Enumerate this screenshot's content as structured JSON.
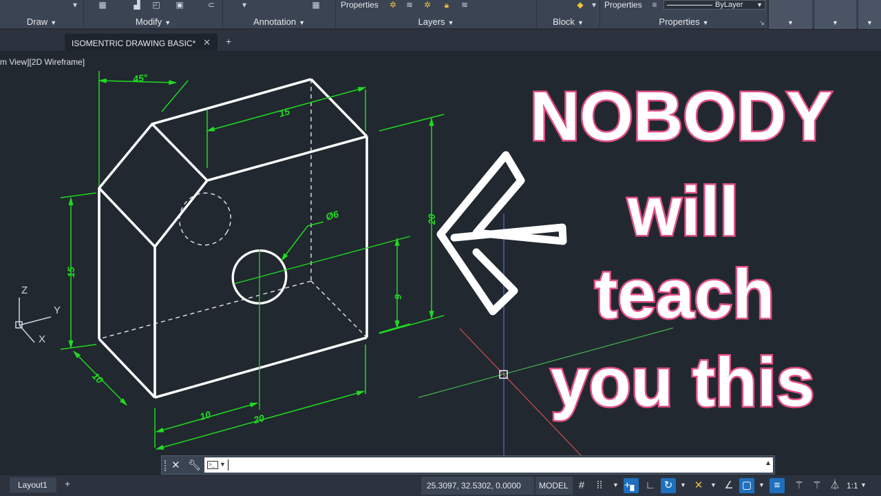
{
  "ribbon": {
    "panels": {
      "draw": "Draw",
      "modify": "Modify",
      "annotation": "Annotation",
      "layers": "Layers",
      "block": "Block",
      "properties": "Properties"
    },
    "layer_properties_label": "Properties",
    "properties_label": "Properties",
    "lineweight_value": "ByLayer"
  },
  "tabs": {
    "active": "ISOMENTRIC DRAWING BASIC*"
  },
  "viewport": {
    "label": "m View][2D Wireframe]"
  },
  "drawing": {
    "dimensions": {
      "angle": "45°",
      "top_width": "15",
      "front_height": "20",
      "left_height": "15",
      "hole_height": "9",
      "hole_diameter": "Ø6",
      "depth": "10",
      "bottom_left": "10",
      "bottom_total": "20"
    },
    "ucs": {
      "z": "Z",
      "y": "Y",
      "x": "X"
    }
  },
  "thumbnail": {
    "line1": "NOBODY",
    "line2": "will",
    "line3": "teach",
    "line4": "you this",
    "fill_color": "#ffffff",
    "stroke_color": "#e34f86"
  },
  "command_line": {
    "value": "",
    "placeholder": ""
  },
  "status": {
    "layout_tab": "Layout1",
    "coordinates": "25.3097, 32.5302, 0.0000",
    "model": "MODEL",
    "scale": "1:1"
  },
  "colors": {
    "canvas": "#212830",
    "ribbon": "#3b4453",
    "dimension": "#1fdc1f",
    "geometry": "#ffffff",
    "accent": "#1e6fbd"
  }
}
